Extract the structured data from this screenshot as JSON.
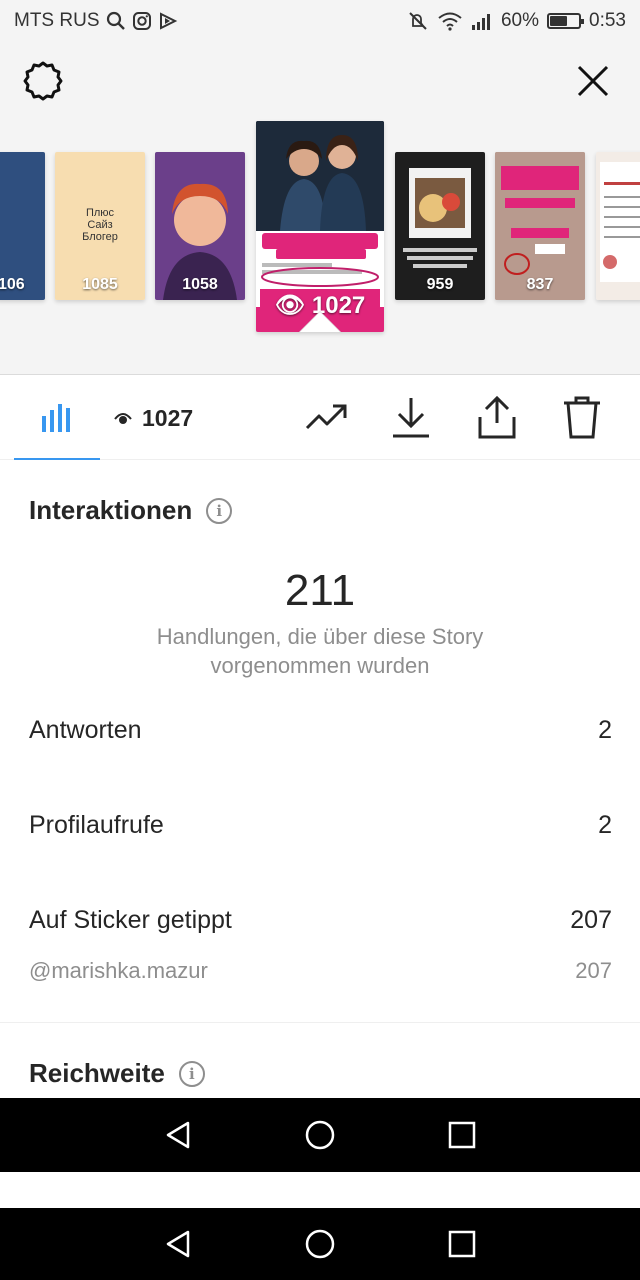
{
  "status_bar": {
    "carrier": "MTS RUS",
    "battery": "60%",
    "battery_level": 0.6,
    "time": "0:53",
    "icons": [
      "search-icon",
      "instagram-icon",
      "app-icon",
      "mute-icon",
      "wifi-icon",
      "signal-icon",
      "battery-icon"
    ]
  },
  "header": {
    "settings_icon": "gear-icon",
    "close_icon": "close-icon"
  },
  "thumbnails": [
    {
      "views": "106",
      "overlay": "",
      "bg": "#2f4f7f"
    },
    {
      "views": "1085",
      "overlay": "Плюс\nСайз\nБлогер",
      "bg": "#f7ddb0"
    },
    {
      "views": "1058",
      "overlay": "",
      "bg": "#6b3f8a"
    },
    {
      "views": "1027",
      "overlay": "",
      "bg": "#1d2a3a",
      "selected": true
    },
    {
      "views": "959",
      "overlay": "",
      "bg": "#1e1e1e"
    },
    {
      "views": "837",
      "overlay": "",
      "bg": "#b89a8e"
    },
    {
      "views": "",
      "overlay": "",
      "bg": "#f3ece6"
    }
  ],
  "toolbar": {
    "views": "1027",
    "icons": [
      "bar-chart-icon",
      "eye-icon",
      "trending-icon",
      "download-icon",
      "share-icon",
      "trash-icon"
    ]
  },
  "interactions": {
    "title": "Interaktionen",
    "total": "211",
    "description": "Handlungen, die über diese Story vorgenommen wurden",
    "rows": [
      {
        "label": "Antworten",
        "value": "2"
      },
      {
        "label": "Profilaufrufe",
        "value": "2"
      },
      {
        "label": "Auf Sticker getippt",
        "value": "207"
      }
    ],
    "sub_row": {
      "label": "@marishka.mazur",
      "value": "207"
    }
  },
  "reach": {
    "title": "Reichweite"
  },
  "nav": {
    "icons": [
      "back-icon",
      "home-icon",
      "recents-icon"
    ]
  },
  "colors": {
    "accent": "#3897f0",
    "text": "#262626",
    "muted": "#8e8e8e",
    "header_bg": "#f4f4f4",
    "pink": "#e0257a"
  }
}
